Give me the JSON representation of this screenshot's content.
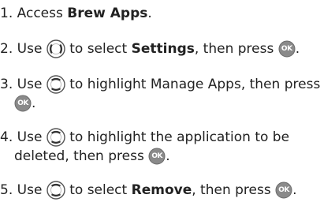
{
  "steps": [
    {
      "number": "1.",
      "text_before": "Access ",
      "bold": "Brew Apps",
      "text_after": "."
    },
    {
      "number": "2.",
      "text_before": "Use",
      "key": "lr-nav-key-icon",
      "text_mid": "to select ",
      "bold": "Settings",
      "text_after": ", then press",
      "end_key": "ok-key-icon",
      "end": "."
    },
    {
      "number": "3.",
      "text_before": "Use",
      "key": "ud-nav-key-icon",
      "text_mid": "to highlight Manage Apps, then press",
      "line2_key": "ok-key-icon",
      "line2_end": "."
    },
    {
      "number": "4.",
      "text_before": "Use",
      "key": "ud-nav-key-icon",
      "text_mid": "to highlight the application to be",
      "line2_text": "deleted, then press",
      "line2_key": "ok-key-icon",
      "line2_end": "."
    },
    {
      "number": "5.",
      "text_before": " Use",
      "key": "ud-nav-key-icon",
      "text_mid": "to select ",
      "bold": "Remove",
      "text_after": ", then press",
      "end_key": "ok-key-icon",
      "end": "."
    }
  ],
  "ok_label": "OK",
  "colors": {
    "text": "#222222",
    "key_fill": "#8a8a8a",
    "key_ring": "#555555"
  }
}
